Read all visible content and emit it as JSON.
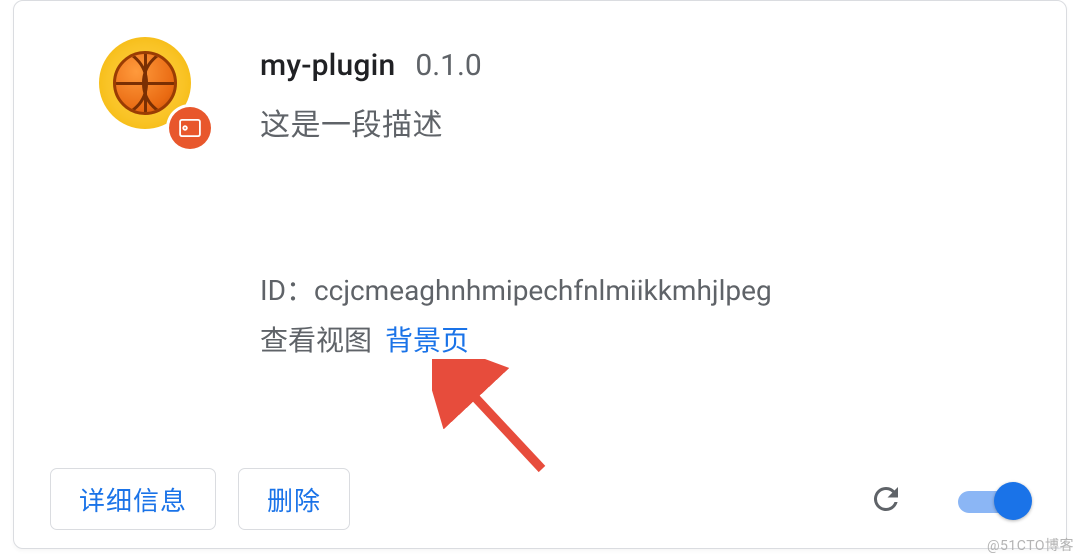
{
  "extension": {
    "name": "my-plugin",
    "version": "0.1.0",
    "description": "这是一段描述",
    "id_label": "ID：",
    "id_value": "ccjcmeaghnhmipechfnlmiikkmhjlpeg",
    "views_label": "查看视图",
    "views_link_text": "背景页"
  },
  "buttons": {
    "details": "详细信息",
    "remove": "删除"
  },
  "toggle": {
    "enabled": true
  },
  "icons": {
    "extension": "basketball-icon",
    "unpacked": "unpacked-icon",
    "reload": "reload-icon"
  },
  "watermark": "@51CTO博客"
}
